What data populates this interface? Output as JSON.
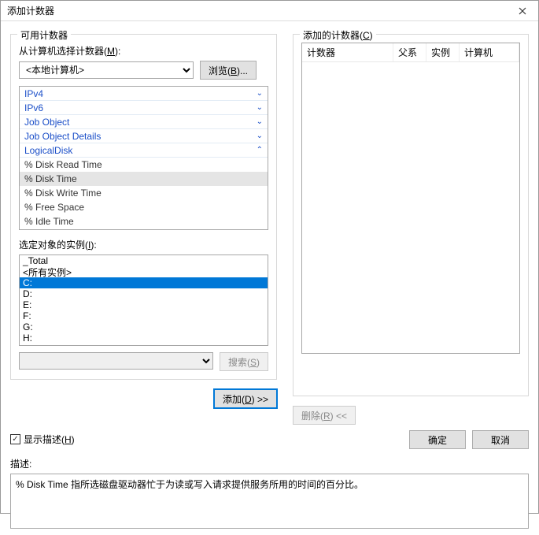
{
  "title": "添加计数器",
  "left": {
    "group_label": "可用计数器",
    "computer_label_pre": "从计算机选择计数器(",
    "computer_label_u": "M",
    "computer_label_post": "):",
    "computer_value": "<本地计算机>",
    "browse_pre": "浏览(",
    "browse_u": "B",
    "browse_post": ")...",
    "categories": [
      {
        "name": "IPv4",
        "expanded": false
      },
      {
        "name": "IPv6",
        "expanded": false
      },
      {
        "name": "Job Object",
        "expanded": false
      },
      {
        "name": "Job Object Details",
        "expanded": false
      },
      {
        "name": "LogicalDisk",
        "expanded": true
      }
    ],
    "counters": [
      {
        "name": "% Disk Read Time",
        "selected": false
      },
      {
        "name": "% Disk Time",
        "selected": true
      },
      {
        "name": "% Disk Write Time",
        "selected": false
      },
      {
        "name": "% Free Space",
        "selected": false
      },
      {
        "name": "% Idle Time",
        "selected": false
      }
    ],
    "instances_label_pre": "选定对象的实例(",
    "instances_label_u": "I",
    "instances_label_post": "):",
    "instances": [
      {
        "name": "_Total",
        "selected": false
      },
      {
        "name": "<所有实例>",
        "selected": false
      },
      {
        "name": "C:",
        "selected": true
      },
      {
        "name": "D:",
        "selected": false
      },
      {
        "name": "E:",
        "selected": false
      },
      {
        "name": "F:",
        "selected": false
      },
      {
        "name": "G:",
        "selected": false
      },
      {
        "name": "H:",
        "selected": false
      }
    ],
    "search_pre": "搜索(",
    "search_u": "S",
    "search_post": ")",
    "add_pre": "添加(",
    "add_u": "D",
    "add_post": ") >>"
  },
  "right": {
    "group_label_pre": "添加的计数器(",
    "group_label_u": "C",
    "group_label_post": ")",
    "col1": "计数器",
    "col2": "父系",
    "col3": "实例",
    "col4": "计算机",
    "remove_pre": "删除(",
    "remove_u": "R",
    "remove_post": ") <<"
  },
  "show_desc_pre": "显示描述(",
  "show_desc_u": "H",
  "show_desc_post": ")",
  "ok": "确定",
  "cancel": "取消",
  "desc_label": "描述:",
  "desc_text": "% Disk Time 指所选磁盘驱动器忙于为读或写入请求提供服务所用的时间的百分比。"
}
